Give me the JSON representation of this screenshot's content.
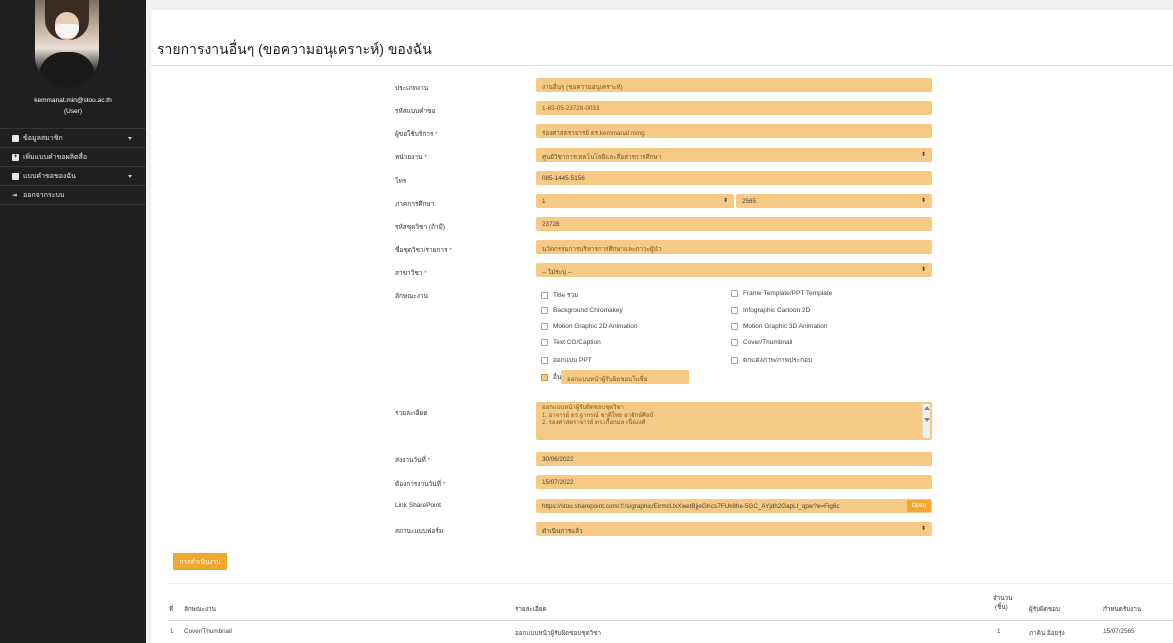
{
  "sidebar": {
    "user_email": "kemmanat.min@stou.ac.th",
    "user_role": "(User)",
    "items": [
      {
        "label": "ข้อมูลสมาชิก",
        "icon": "profile-icon",
        "has_caret": true
      },
      {
        "label": "เพิ่มแบบคำขอผลิตสื่อ",
        "icon": "plus-icon",
        "has_caret": false
      },
      {
        "label": "แบบคำขอของฉัน",
        "icon": "list-icon",
        "has_caret": true
      },
      {
        "label": "ออกจากระบบ",
        "icon": "logout-icon",
        "has_caret": false
      }
    ]
  },
  "page": {
    "title": "รายการงานอื่นๆ (ขอความอนุเคราะห์) ของฉัน"
  },
  "form": {
    "type_label": "ประเภทงาน",
    "type_value": "งานอื่นๆ (ขอความอนุเคราะห์)",
    "code_label": "รหัสแบบคำขอ",
    "code_value": "1-65-05-23728-0033",
    "requester_label": "ผู้ขอใช้บริการ",
    "requester_value": "รองศาสตราจารย์ ดร.kemmanat ming",
    "unit_label": "หน่วยงาน",
    "unit_value": "ศูนย์วิชาการเทคโนโลยีและสื่อสารการศึกษา",
    "phone_label": "โทร",
    "phone_value": "085-1445-5156",
    "semester_label": "ภาคการศึกษา",
    "semester_value": "1",
    "year_value": "2565",
    "course_code_label": "รหัสชุดวิชา (ถ้ามี)",
    "course_code_value": "23728",
    "course_name_label": "ชื่อชุดวิชา/รายการ",
    "course_name_value": "นวัตกรรมการบริหารการศึกษาและภาวะผู้นำ",
    "major_label": "สาขาวิชา",
    "major_value": "-- ไม่ระบุ --",
    "features_label": "ลักษณะงาน",
    "features_left": [
      {
        "label": "Title รวม",
        "checked": false
      },
      {
        "label": "Background Chromakey",
        "checked": false
      },
      {
        "label": "Motion Graphic 2D Animation",
        "checked": false
      },
      {
        "label": "Text CG/Caption",
        "checked": false
      },
      {
        "label": "ออกแบบ PPT",
        "checked": false
      },
      {
        "label": "อื่นๆ",
        "checked": true
      }
    ],
    "features_right": [
      {
        "label": "Frame Template/PPT Template",
        "checked": false
      },
      {
        "label": "Infographic Cartoon 2D",
        "checked": false
      },
      {
        "label": "Motion Graphic 3D Animation",
        "checked": false
      },
      {
        "label": "Cover/Thumbnail",
        "checked": false
      },
      {
        "label": "ตกแต่งภาพ/ภาพประกอบ",
        "checked": false
      }
    ],
    "other_value": "ออกแบบหน้าผู้รับผิดชอบในชื่อ",
    "detail_label": "รายละเอียด",
    "detail_lines": [
      "ออกแบบหน้าผู้รับผิดชอบชุดวิชา",
      "1. อาจารย์ ดร.ฐากรณ์ ชาติไทย อาจักษ์ศิลป์",
      "2. รองศาสตราจารย์ ดร.เกื้อกมล เนื่องงศ์"
    ],
    "send_date_label": "ส่งงานวันที่",
    "send_date_value": "30/06/2022",
    "due_date_label": "ต้องการงานวันที่",
    "due_date_value": "15/07/2022",
    "sharepoint_label": "Link SharePoint",
    "sharepoint_value": "https://stou.sharepoint.com/:f:/s/graphic/EirmcUxXwetBjjeGKcs7FUk8he-5GC_AYjdh2GapLI_qpw?e=Fig6c",
    "open_label": "Open",
    "status_label": "สถานะแบบฟอร์ม",
    "status_value": "ดำเนินการแล้ว"
  },
  "actions": {
    "submit_label": "การดำเนินงาน"
  },
  "table": {
    "headers": {
      "no": "ที่",
      "feature": "ลักษณะงาน",
      "detail": "รายละเอียด",
      "qty_line1": "จำนวน",
      "qty_line2": "(ชิ้น)",
      "owner": "ผู้รับผิดชอบ",
      "due": "กำหนดรับงาน"
    },
    "rows": [
      {
        "no": "1",
        "feature": "Cover/Thumbnail",
        "detail": "ออกแบบหน้าผู้รับผิดชอบชุดวิชา",
        "qty": "1",
        "owner": "ภาคิน อ้อยรุ่ง",
        "due": "15/07/2565"
      }
    ]
  }
}
